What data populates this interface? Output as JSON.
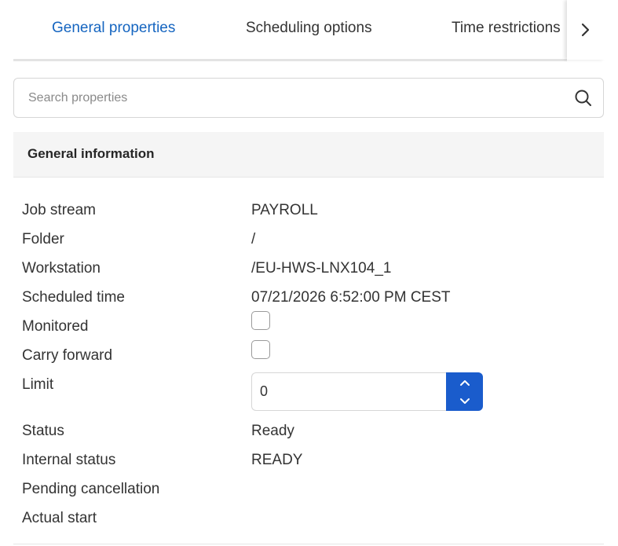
{
  "tabs": [
    {
      "label": "General properties",
      "active": true
    },
    {
      "label": "Scheduling options",
      "active": false
    },
    {
      "label": "Time restrictions",
      "active": false
    }
  ],
  "tabs_next_icon": "chevron-right-icon",
  "search": {
    "placeholder": "Search properties",
    "value": "",
    "icon": "search-icon"
  },
  "section": {
    "title": "General information"
  },
  "properties": {
    "job_stream": {
      "label": "Job stream",
      "value": "PAYROLL"
    },
    "folder": {
      "label": "Folder",
      "value": "/"
    },
    "workstation": {
      "label": "Workstation",
      "value": "/EU-HWS-LNX104_1"
    },
    "scheduled_time": {
      "label": "Scheduled time",
      "value": "07/21/2026 6:52:00 PM CEST"
    },
    "monitored": {
      "label": "Monitored",
      "checked": false
    },
    "carry_forward": {
      "label": "Carry forward",
      "checked": false
    },
    "limit": {
      "label": "Limit",
      "value": "0"
    },
    "status": {
      "label": "Status",
      "value": "Ready"
    },
    "internal_status": {
      "label": "Internal status",
      "value": "READY"
    },
    "pending_cancellation": {
      "label": "Pending cancellation",
      "value": ""
    },
    "actual_start": {
      "label": "Actual start",
      "value": ""
    }
  },
  "colors": {
    "accent": "#1a5ccc",
    "active_tab_text": "#1565c0",
    "section_bg": "#f5f5f5"
  }
}
